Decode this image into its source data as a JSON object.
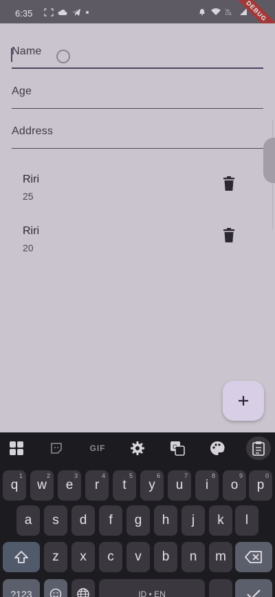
{
  "status": {
    "time": "6:35",
    "debug_label": "DEBUG"
  },
  "form": {
    "name_label": "Name",
    "age_label": "Age",
    "address_label": "Address"
  },
  "items": [
    {
      "name": "Riri",
      "age": "25"
    },
    {
      "name": "Riri",
      "age": "20"
    }
  ],
  "fab_icon": "add-icon",
  "keyboard": {
    "toolbar": [
      "apps-grid-icon",
      "sticker-icon",
      "GIF",
      "settings-gear-icon",
      "translate-icon",
      "palette-icon",
      "clipboard-icon"
    ],
    "gif_label": "GIF",
    "row1": [
      {
        "k": "q",
        "h": "1"
      },
      {
        "k": "w",
        "h": "2"
      },
      {
        "k": "e",
        "h": "3"
      },
      {
        "k": "r",
        "h": "4"
      },
      {
        "k": "t",
        "h": "5"
      },
      {
        "k": "y",
        "h": "6"
      },
      {
        "k": "u",
        "h": "7"
      },
      {
        "k": "i",
        "h": "8"
      },
      {
        "k": "o",
        "h": "9"
      },
      {
        "k": "p",
        "h": "0"
      }
    ],
    "row2": [
      "a",
      "s",
      "d",
      "f",
      "g",
      "h",
      "j",
      "k",
      "l"
    ],
    "row3": [
      "z",
      "x",
      "c",
      "v",
      "b",
      "n",
      "m"
    ],
    "symbols_label": "?123",
    "space_label": "ID • EN",
    "colors": {
      "background": "#1c1b1f",
      "key": "#3a383e",
      "special": "#5a5f6b"
    }
  }
}
